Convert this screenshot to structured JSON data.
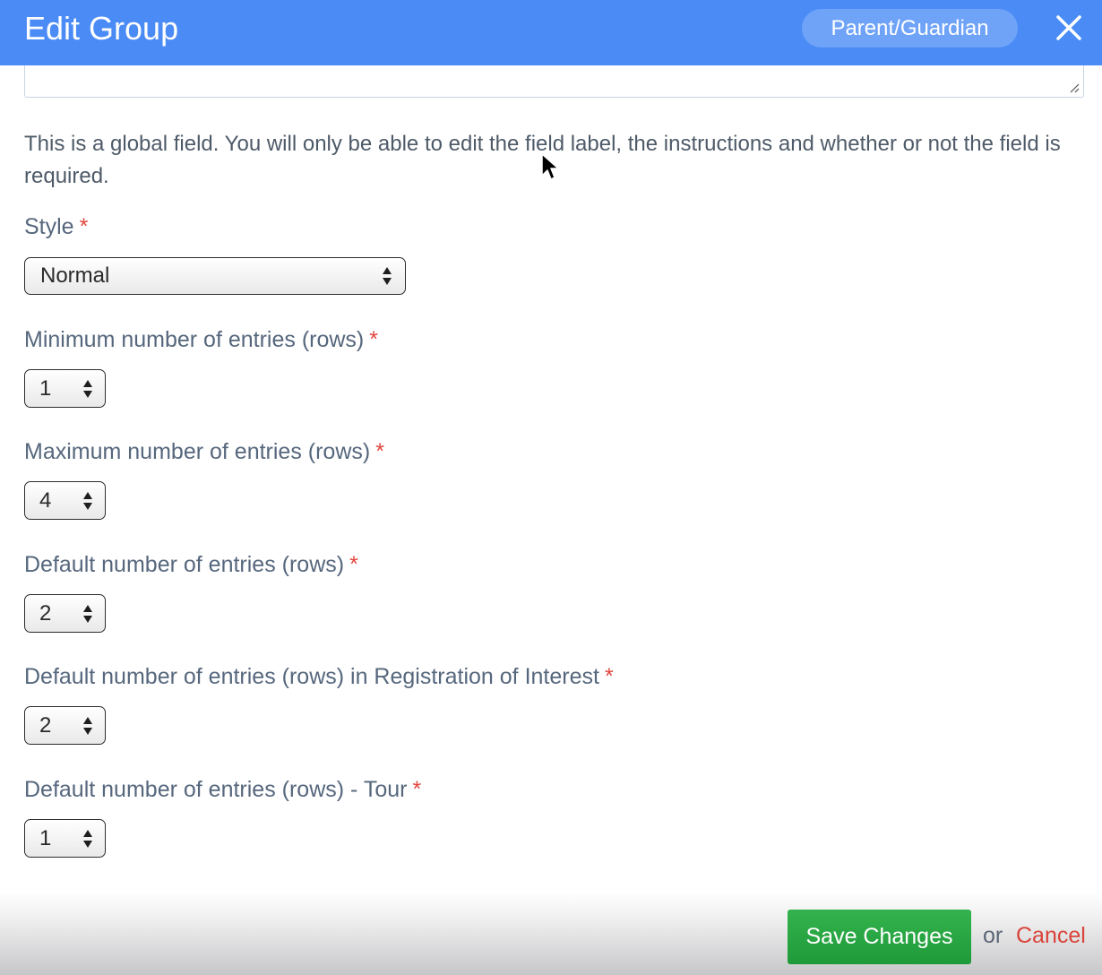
{
  "header": {
    "title": "Edit Group",
    "badge": "Parent/Guardian",
    "close_icon": "close-icon"
  },
  "note": "This is a global field. You will only be able to edit the field label, the instructions and whether or not the field is required.",
  "required_marker": "*",
  "fields": [
    {
      "label": "Style",
      "value": "Normal"
    },
    {
      "label": "Minimum number of entries (rows)",
      "value": "1"
    },
    {
      "label": "Maximum number of entries (rows)",
      "value": "4"
    },
    {
      "label": "Default number of entries (rows)",
      "value": "2"
    },
    {
      "label": "Default number of entries (rows) in Registration of Interest",
      "value": "2"
    },
    {
      "label": "Default number of entries (rows) - Tour",
      "value": "1"
    }
  ],
  "footer": {
    "save_label": "Save Changes",
    "or_text": "or",
    "cancel_label": "Cancel"
  },
  "colors": {
    "header_bg": "#4a8bf6",
    "required": "#e0463f",
    "save_bg": "#28a745",
    "cancel": "#d9433b"
  }
}
